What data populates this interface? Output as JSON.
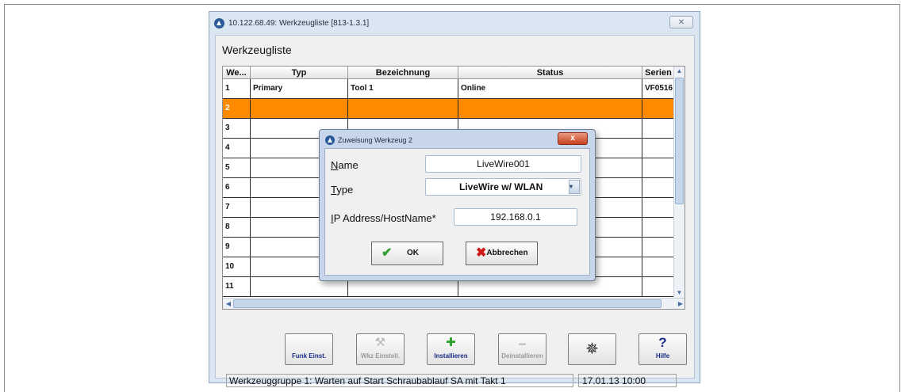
{
  "window": {
    "title": "10.122.68.49: Werkzeugliste [813-1.3.1]",
    "close_glyph": "✕",
    "heading": "Werkzeugliste"
  },
  "grid": {
    "columns": [
      "We...",
      "Typ",
      "Bezeichnung",
      "Status",
      "Serien"
    ],
    "rows": [
      [
        "1",
        "Primary",
        "Tool 1",
        "Online",
        "VF0516"
      ],
      [
        "2",
        "",
        "",
        "",
        ""
      ],
      [
        "3",
        "",
        "",
        "",
        ""
      ],
      [
        "4",
        "",
        "",
        "",
        ""
      ],
      [
        "5",
        "",
        "",
        "",
        ""
      ],
      [
        "6",
        "",
        "",
        "",
        ""
      ],
      [
        "7",
        "",
        "",
        "",
        ""
      ],
      [
        "8",
        "",
        "",
        "",
        ""
      ],
      [
        "9",
        "",
        "",
        "",
        ""
      ],
      [
        "10",
        "",
        "",
        "",
        ""
      ],
      [
        "11",
        "",
        "",
        "",
        ""
      ]
    ],
    "selected_row": 2,
    "selected_color": "#ff8a00"
  },
  "toolbar": {
    "funk_label": "Funk Einst.",
    "wkz_label": "Wkz Einstell.",
    "install_label": "Installieren",
    "uninstall_label": "Deinstallieren",
    "hilfe_label": "Hilfe",
    "hilfe_glyph": "?",
    "install_glyph": "✚",
    "uninstall_glyph": "▬",
    "wheel_glyph": "✵"
  },
  "status": {
    "message": "Werkzeuggruppe 1: Warten auf Start Schraubablauf SA mit Takt 1",
    "datetime": "17.01.13 10:00"
  },
  "dialog": {
    "title": "Zuweisung Werkzeug  2",
    "close_glyph": "x",
    "name_label_mnemonic": "N",
    "name_label_rest": "ame",
    "name_value": "LiveWire001",
    "type_label_mnemonic": "T",
    "type_label_rest": "ype",
    "type_value": "LiveWire w/ WLAN",
    "ip_label_mnemonic": "I",
    "ip_label_rest": "P Address/HostName*",
    "ip_value": "192.168.0.1",
    "ok_label": "OK",
    "ok_glyph": "✔",
    "cancel_label": "Abbrechen",
    "cancel_glyph": "✖"
  },
  "colors": {
    "accent_selected": "#ff8a00",
    "ok_icon": "#2e9e2e",
    "cancel_icon": "#d01818",
    "install_icon": "#2aa52a",
    "toolbar_label": "#1a2d88"
  },
  "icons": [
    "app-icon",
    "tool-icon",
    "plus-icon",
    "minus-icon",
    "wheel-icon",
    "help-icon",
    "check-icon",
    "cross-icon"
  ]
}
